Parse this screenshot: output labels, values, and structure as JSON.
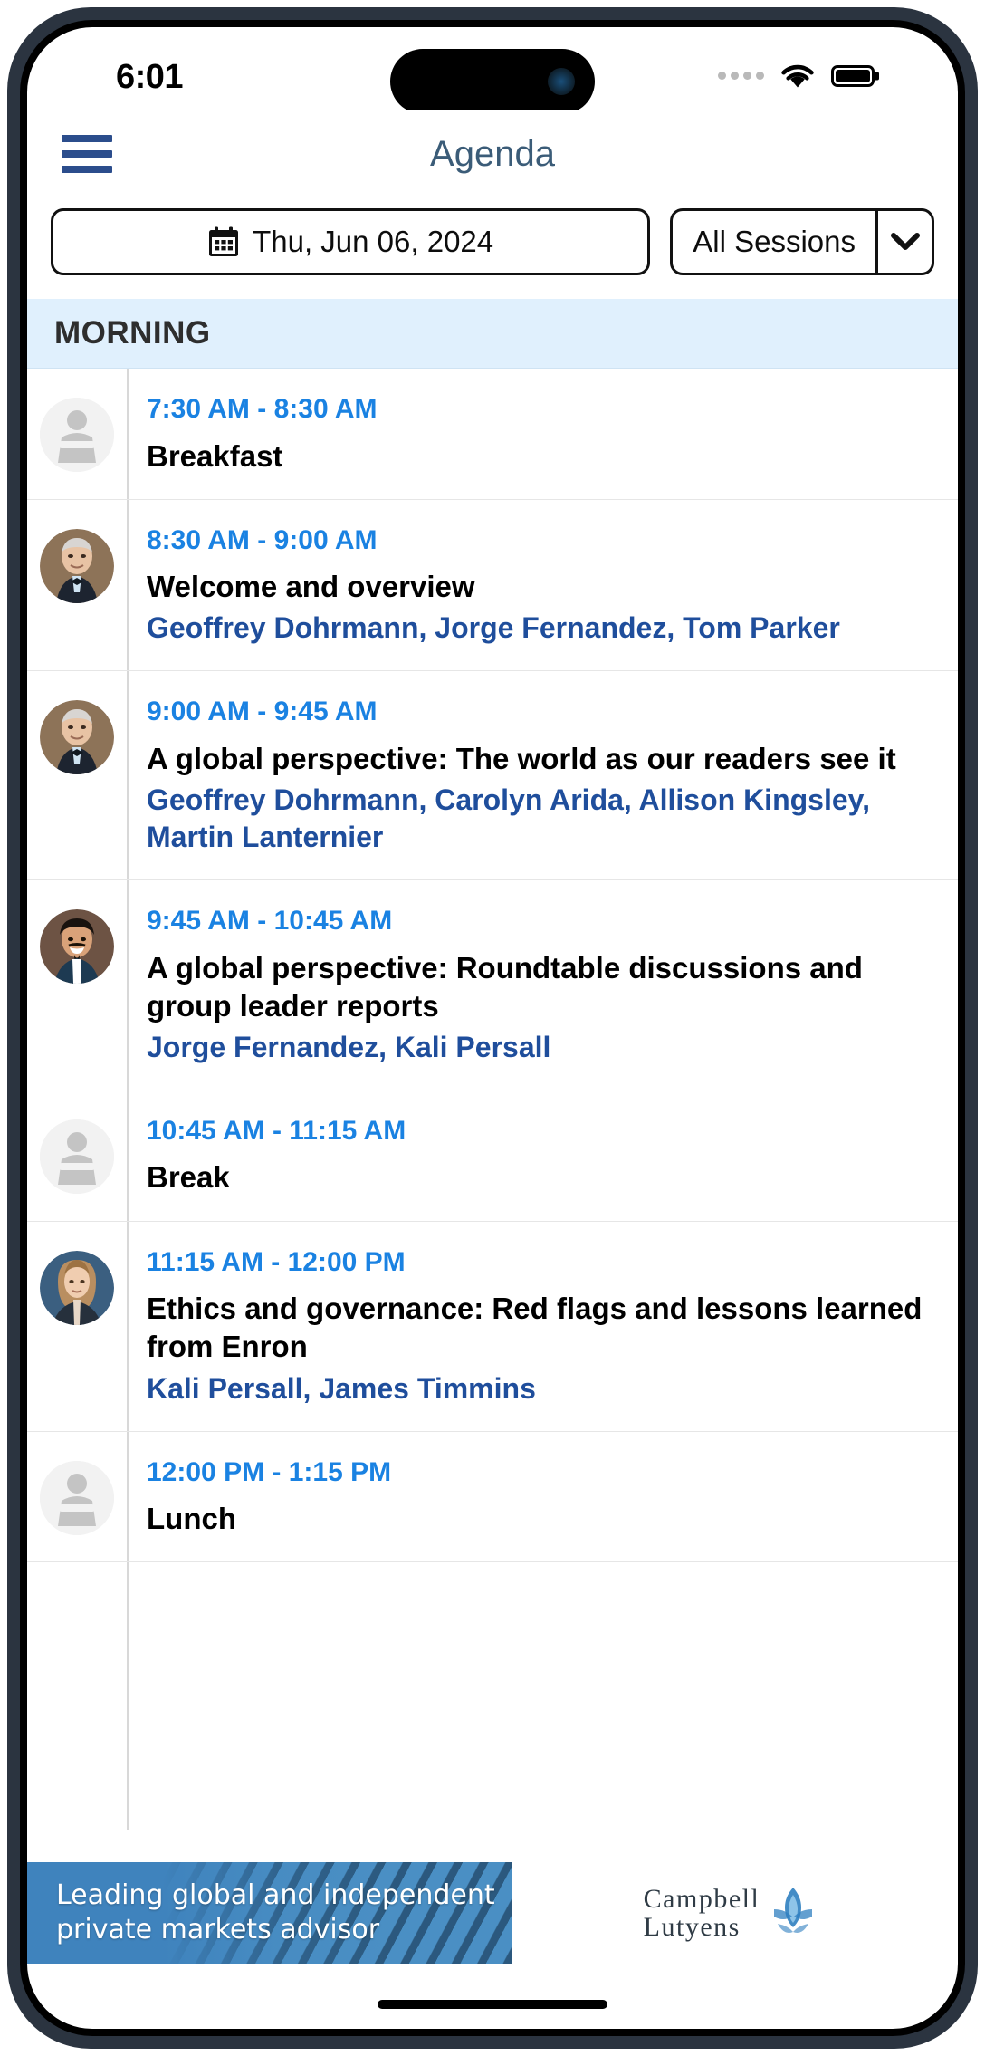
{
  "status_bar": {
    "time": "6:01",
    "icons": [
      "signal-dots-icon",
      "wifi-icon",
      "battery-icon"
    ]
  },
  "header": {
    "title": "Agenda",
    "menu_icon": "hamburger-menu-icon"
  },
  "filters": {
    "date": {
      "icon": "calendar-icon",
      "label": "Thu, Jun 06, 2024"
    },
    "session": {
      "value": "All Sessions",
      "caret_icon": "chevron-down-icon"
    }
  },
  "sections": [
    {
      "label": "MORNING",
      "items": [
        {
          "time": "7:30 AM - 8:30 AM",
          "title": "Breakfast",
          "speakers": "",
          "avatar": "podium-placeholder-icon"
        },
        {
          "time": "8:30 AM - 9:00 AM",
          "title": "Welcome and overview",
          "speakers": "Geoffrey Dohrmann, Jorge Fernandez, Tom Parker",
          "avatar": "speaker-photo-geoffrey-dohrmann"
        },
        {
          "time": "9:00 AM - 9:45 AM",
          "title": "A global perspective: The world as our readers see it",
          "speakers": "Geoffrey Dohrmann, Carolyn Arida, Allison Kingsley, Martin Lanternier",
          "avatar": "speaker-photo-geoffrey-dohrmann"
        },
        {
          "time": "9:45 AM - 10:45 AM",
          "title": "A global perspective: Roundtable discussions and group leader reports",
          "speakers": "Jorge Fernandez, Kali Persall",
          "avatar": "speaker-photo-jorge-fernandez"
        },
        {
          "time": "10:45 AM - 11:15 AM",
          "title": "Break",
          "speakers": "",
          "avatar": "podium-placeholder-icon"
        },
        {
          "time": "11:15 AM - 12:00 PM",
          "title": "Ethics and governance: Red flags and lessons learned from Enron",
          "speakers": "Kali Persall, James Timmins",
          "avatar": "speaker-photo-kali-persall"
        },
        {
          "time": "12:00 PM - 1:15 PM",
          "title": "Lunch",
          "speakers": "",
          "avatar": "podium-placeholder-icon"
        }
      ]
    }
  ],
  "sponsor_banner": {
    "tagline": "Leading global and independent private markets advisor",
    "logo_line1": "Campbell",
    "logo_line2": "Lutyens",
    "logo_mark": "campbell-lutyens-leaf-icon"
  },
  "colors": {
    "accent_time": "#1a82e2",
    "speaker_link": "#1f4e9c",
    "header_title": "#3b5c78",
    "section_bg": "#e0f0fd",
    "menu_blue": "#2b4d8c",
    "sponsor_blue": "#4a8fc4"
  }
}
